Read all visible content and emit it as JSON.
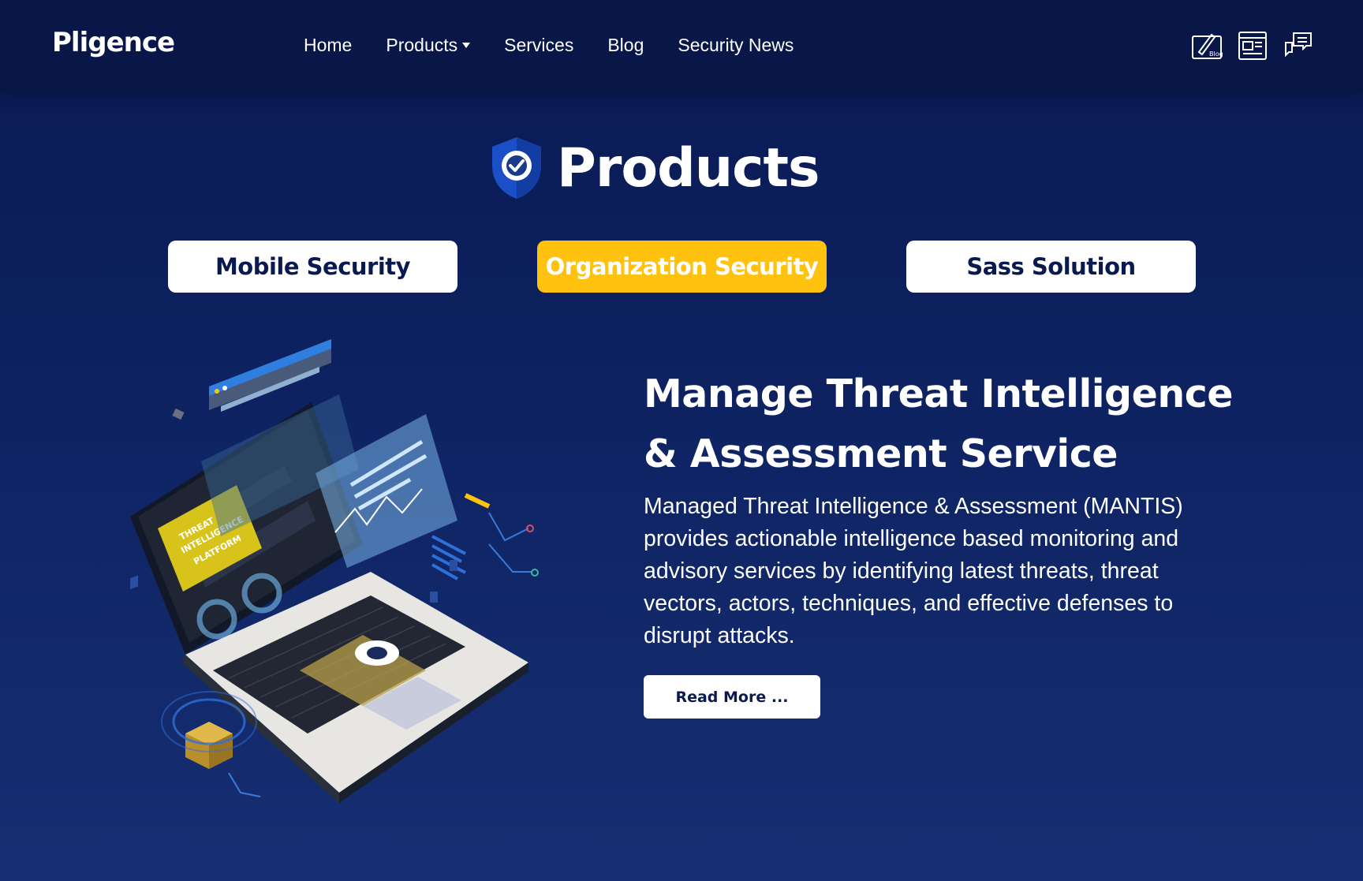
{
  "header": {
    "logo_text": "Pligence",
    "nav": [
      {
        "label": "Home",
        "has_dropdown": false
      },
      {
        "label": "Products",
        "has_dropdown": true
      },
      {
        "label": "Services",
        "has_dropdown": false
      },
      {
        "label": "Blog",
        "has_dropdown": false
      },
      {
        "label": "Security News",
        "has_dropdown": false
      }
    ],
    "icons": [
      {
        "name": "blog-icon",
        "label": "Blog"
      },
      {
        "name": "security-news-icon",
        "label": "Security News"
      },
      {
        "name": "chat-icon",
        "label": ""
      }
    ]
  },
  "section": {
    "title": "Products",
    "title_icon": "shield-check-icon"
  },
  "tabs": [
    {
      "label": "Mobile Security",
      "active": false
    },
    {
      "label": "Organization Security",
      "active": true
    },
    {
      "label": "Sass Solution",
      "active": false
    }
  ],
  "product": {
    "headline_line1": "Manage Threat Intelligence",
    "headline_line2": "& Assessment Service",
    "description": "Managed Threat Intelligence & Assessment (MANTIS) provides actionable intelligence based monitoring and advisory services by identifying latest threats, threat vectors, actors, techniques, and effective defenses to disrupt attacks.",
    "read_more": "Read More ...",
    "illustration_badge": [
      "THREAT",
      "INTELLIGENCE",
      "PLATFORM"
    ]
  },
  "colors": {
    "accent": "#ffc20e",
    "background": "#0d2160",
    "header": "#081748",
    "text_dark": "#0a1a4e"
  }
}
